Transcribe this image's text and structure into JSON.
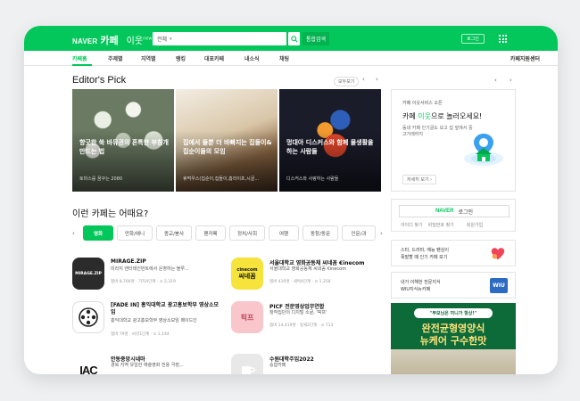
{
  "header": {
    "brand_naver": "NAVER",
    "brand_cafe": "카페",
    "brand_ioot": "이웃",
    "brand_new": "new",
    "search_scope": "전체",
    "search_value": "",
    "integrated_search": "통합검색",
    "login": "로그인"
  },
  "nav": {
    "items": [
      "카페홈",
      "주제별",
      "지역별",
      "랭킹",
      "대표카페",
      "내소식",
      "채팅"
    ],
    "right": "카페지원센터"
  },
  "editors_pick": {
    "title": "Editor's Pick",
    "more": "모두보기",
    "cards": [
      {
        "title": "향긋한 쑥 바뮤권의 혼특한 부침개 만드는 법",
        "desc": "토마스를 꿈꾸는 2080"
      },
      {
        "title": "집에서 들뿐 더 바빠지는 집돌이&집순이들의 모임",
        "desc": "휴먹우스(집순이,집돌이,홈라이프,시골..."
      },
      {
        "title": "멍대아 디스커스와 함께 물생활을 하는 사람들",
        "desc": "디스커스와 사랑하는 사람들"
      }
    ]
  },
  "right_panel": {
    "small": "카페 이웃서비스 오픈",
    "head_pre": "카페 ",
    "head_green": "이웃",
    "head_post": "으로 놀러오세요!",
    "body": "동네 카페 인기글도 보고 집 앞에서 중고거래하지",
    "detail": "자세히 보기 ›",
    "login_naver": "NAVER",
    "login_label": "로그인",
    "login_links": [
      "아이디 찾기",
      "비밀번호 찾기",
      "회원가입"
    ],
    "promo1_l1": "스타, 드라마, 예능 팬심이",
    "promo1_l2": "폭발할 때 인기 카페 보기",
    "promo2_l1": "내가 이해한 전문지식",
    "promo2_l2": "WIU지식뉴카페",
    "wiu": "WIU",
    "ad_top": "\"부모님은 끼니가 항상!\"",
    "ad_line1": "완전균형영양식",
    "ad_line2": "뉴케어 구수한맛"
  },
  "recommend": {
    "title": "이런 카페는 어때요?",
    "categories": [
      "영화",
      "만화/애니",
      "종교/봉사",
      "팬카페",
      "정치/사회",
      "여행",
      "동창/동문",
      "인문/과"
    ],
    "cafes": [
      {
        "name": "MIRAGE.ZIP",
        "desc": "미라지 엔터테인먼트에서 운영하는 블루...",
        "meta": "멤버 8,766명 · 가치4단계 · ⊙ 2,319",
        "thumb": "MIRAGE.ZIP"
      },
      {
        "name": "서울대학교 영화공동체 씨네꼼 €inecom",
        "desc": "서울대학교 영화공동체 씨네꼼 €inecom",
        "meta": "멤버 410명 · 새싹4단계 · ⊙ 1,258",
        "thumb1": "cinecom",
        "thumb2": "씨네꼼"
      },
      {
        "name": "[FADE IN] 홍익대학교 광고홍보학부 영상소모임",
        "desc": "홍익대학교 광고홍보학부 영상소모임 페이드인",
        "meta": "멤버 79명 · 씨앗1단계 · ⊙ 1,144"
      },
      {
        "name": "PICF 전문영상업무연합",
        "desc": "창작집단의 디지털 소굴, '픽프'",
        "meta": "멤버 14,419명 · 잎새2단계 · ⊙ 713",
        "thumb": "픽프"
      },
      {
        "name": "안동중앙시네마",
        "desc": "경북 지역 유일한 예술영화 전용 극장,..",
        "thumb": "IAC"
      },
      {
        "name": "수원대학주임2022",
        "desc": "숭합카페"
      }
    ]
  },
  "colors": {
    "brand_green": "#03c75a"
  }
}
